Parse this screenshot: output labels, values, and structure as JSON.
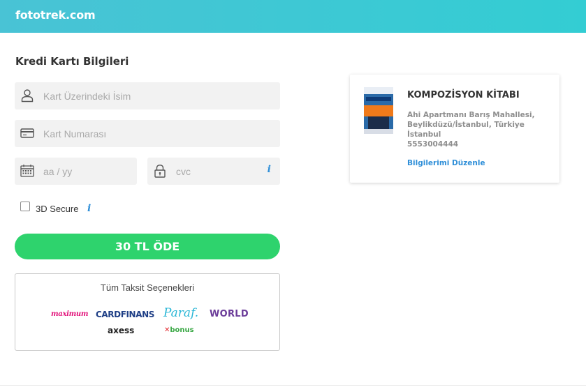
{
  "header": {
    "brand": "fototrek.com",
    "bg_color": "#3ac9d4"
  },
  "form": {
    "title": "Kredi Kartı Bilgileri",
    "name_placeholder": "Kart Üzerindeki İsim",
    "number_placeholder": "Kart Numarası",
    "expiry_placeholder": "aa / yy",
    "cvc_placeholder": "cvc",
    "info_glyph": "i",
    "secure_label": "3D Secure",
    "secure_checked": false,
    "pay_label": "30 TL ÖDE",
    "pay_color": "#2ed36d"
  },
  "installments": {
    "title": "Tüm Taksit Seçenekleri",
    "logos": {
      "maximum": "maximum",
      "cardfinans": "CARDFINANS",
      "paraf": "Paraf.",
      "world": "WORLD",
      "axess": "axess",
      "bonus_prefix": "✕",
      "bonus": "bonus"
    }
  },
  "product": {
    "title": "KOMPOZİSYON KİTABI",
    "address": "Ahi Apartmanı Barış Mahallesi, Beylikdüzü/İstanbul, Türkiye İstanbul",
    "phone": "5553004444",
    "edit_label": "Bilgilerimi Düzenle",
    "link_color": "#2f8fd8"
  },
  "icons": {
    "name": "user-icon",
    "card": "credit-card-icon",
    "expiry": "calendar-icon",
    "cvc": "lock-icon",
    "info": "info-icon"
  }
}
